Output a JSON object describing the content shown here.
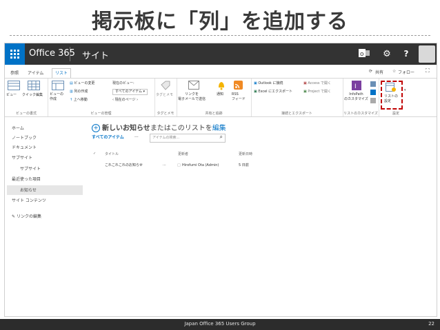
{
  "slide": {
    "title": "掲示板に「列」を追加する"
  },
  "topbar": {
    "brand": "Office 365",
    "site": "サイト"
  },
  "ribbon_tabs": [
    {
      "label": "参照"
    },
    {
      "label": "アイテム"
    },
    {
      "label": "リスト"
    }
  ],
  "ribbon_right": {
    "share": "共有",
    "follow": "フォロー"
  },
  "ribbon": {
    "view_format": {
      "view": "ビュー",
      "quick_edit": "クイック編集",
      "label": "ビューの書式"
    },
    "view_manage": {
      "create_view": "ビューの\n作成",
      "modify_view": "ビューの変更",
      "current_view_label": "現在のビュー:",
      "create_column": "列の作成",
      "current_view_value": "すべてのアイテム",
      "navigate_up": "上へ移動",
      "current_page": "現在のページ",
      "label": "ビューの管理"
    },
    "tags": {
      "tags_notes": "タグとメモ",
      "label": "タグとメモ"
    },
    "share_track": {
      "email_link": "リンクを\n電子メールで送信",
      "alert": "通知",
      "rss": "RSS\nフィード",
      "label": "共有と追跡"
    },
    "connect_export": {
      "outlook": "Outlook に接続",
      "excel": "Excel にエクスポート",
      "access": "Access で開く",
      "project": "Project で開く",
      "label": "接続とエクスポート"
    },
    "customize": {
      "infopath": "InfoPath\nのカスタマイズ",
      "label": "リストのカスタマイズ"
    },
    "settings": {
      "list_settings": "リストの\n設定",
      "label": "設定"
    }
  },
  "leftnav": {
    "items": [
      "ホーム",
      "ノートブック",
      "ドキュメント",
      "サブサイト",
      "サブサイト",
      "最近使った項目",
      "お知らせ",
      "サイト コンテンツ"
    ],
    "edit_links": "リンクの編集"
  },
  "main": {
    "new_item": "新しいお知らせ",
    "title_middle": "またはこのリストを",
    "edit": "編集",
    "all_items": "すべてのアイテム",
    "more": "···",
    "search_placeholder": "アイテムの検索...",
    "columns": {
      "title": "タイトル",
      "modified_by": "更新者",
      "modified": "更新日時"
    },
    "rows": [
      {
        "title": "これこれこれのお知らせ",
        "ellipsis": "···",
        "modified_by": "Hirofumi Ota (Admin)",
        "modified": "5 日前"
      }
    ]
  },
  "footer": {
    "text": "Japan Office 365 Users Group",
    "page": "22"
  },
  "colors": {
    "accent": "#0072c6",
    "topbar": "#333333",
    "highlight": "#c00000",
    "footer": "#2c2c2c"
  }
}
